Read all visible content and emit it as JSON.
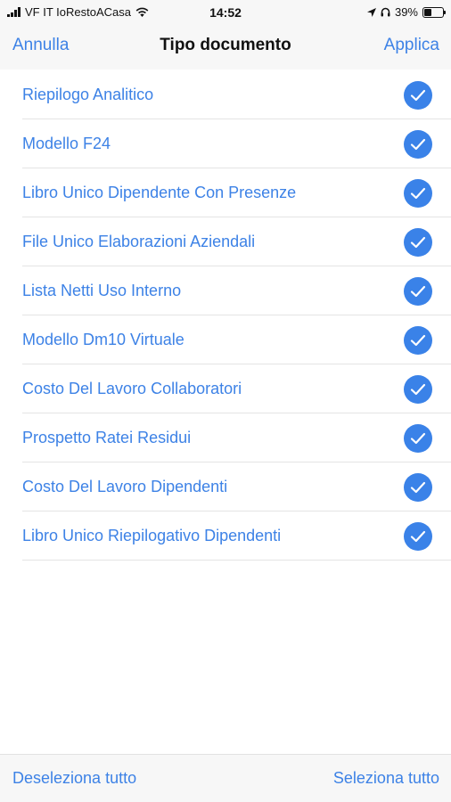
{
  "status_bar": {
    "carrier": "VF IT IoRestoACasa",
    "time": "14:52",
    "battery": "39%",
    "battery_level": 0.39,
    "icons": [
      "signal-icon",
      "wifi-icon",
      "location-icon",
      "headphones-icon",
      "battery-icon"
    ]
  },
  "navbar": {
    "cancel_label": "Annulla",
    "title": "Tipo documento",
    "apply_label": "Applica"
  },
  "documents": [
    {
      "label": "Riepilogo Analitico",
      "checked": true
    },
    {
      "label": "Modello F24",
      "checked": true
    },
    {
      "label": "Libro Unico Dipendente Con Presenze",
      "checked": true
    },
    {
      "label": "File Unico Elaborazioni Aziendali",
      "checked": true
    },
    {
      "label": "Lista Netti Uso Interno",
      "checked": true
    },
    {
      "label": "Modello Dm10 Virtuale",
      "checked": true
    },
    {
      "label": "Costo Del Lavoro Collaboratori",
      "checked": true
    },
    {
      "label": "Prospetto Ratei Residui",
      "checked": true
    },
    {
      "label": "Costo Del Lavoro Dipendenti",
      "checked": true
    },
    {
      "label": "Libro Unico Riepilogativo Dipendenti",
      "checked": true
    }
  ],
  "toolbar": {
    "deselect_all_label": "Deseleziona tutto",
    "select_all_label": "Seleziona tutto"
  },
  "colors": {
    "accent": "#3d82e6",
    "checkmark": "#3a82e8",
    "bar_background": "#f7f7f7",
    "separator": "#e4e4e4"
  }
}
